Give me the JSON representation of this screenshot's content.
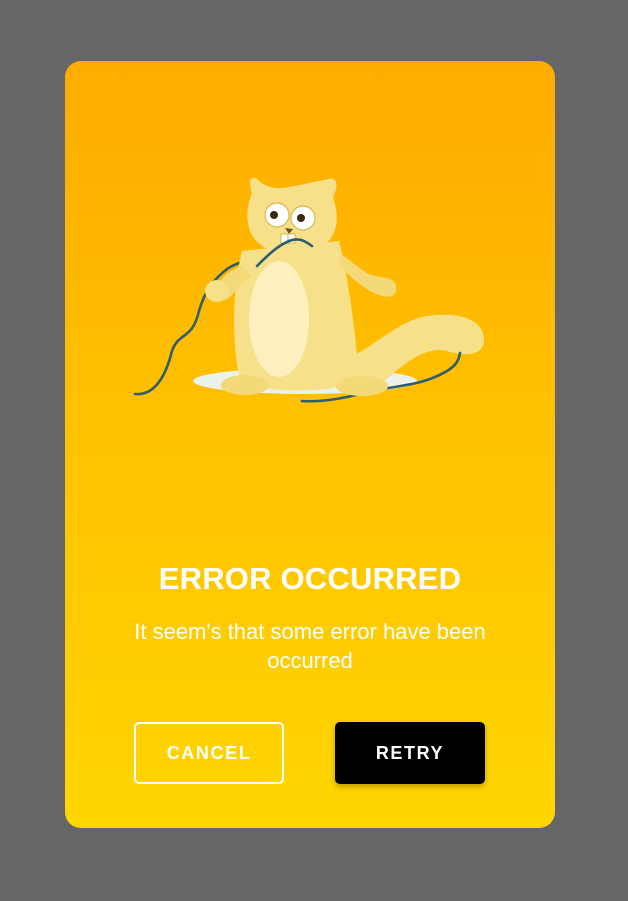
{
  "dialog": {
    "title": "ERROR OCCURRED",
    "message": "It seem's that some error have been occurred",
    "illustration": "cat-chewing-cable-illustration",
    "buttons": {
      "cancel_label": "CANCEL",
      "retry_label": "RETRY"
    },
    "colors": {
      "overlay": "#666666",
      "gradient_top": "#FFAC00",
      "gradient_bottom": "#FFD600",
      "text": "#FFFFFF",
      "retry_background": "#000000"
    }
  }
}
